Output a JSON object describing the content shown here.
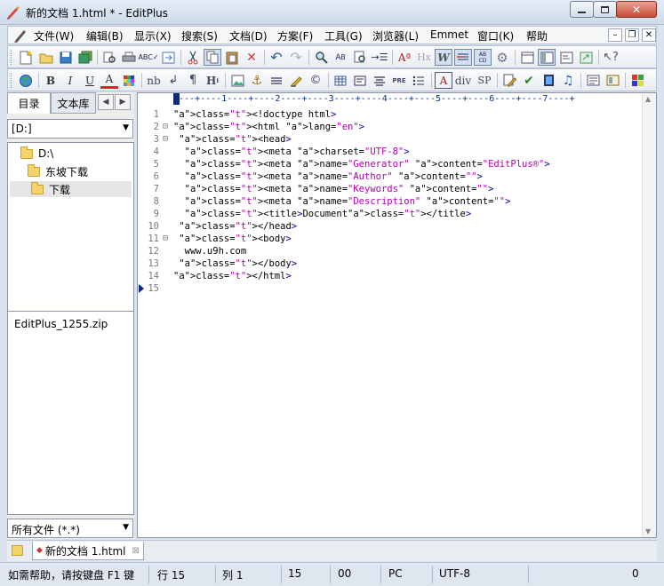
{
  "window": {
    "title": "新的文档 1.html * - EditPlus"
  },
  "menu": [
    "文件(W)",
    "编辑(B)",
    "显示(X)",
    "搜索(S)",
    "文档(D)",
    "方案(F)",
    "工具(G)",
    "浏览器(L)",
    "Emmet",
    "窗口(K)",
    "帮助"
  ],
  "toolbar2_text": {
    "hx": "Hx",
    "nb": "nb",
    "hh": "H",
    "pre": "PRE",
    "div": "div",
    "sp": "SP",
    "abcd": "AB CD"
  },
  "sidebar": {
    "tabs": [
      "目录",
      "文本库"
    ],
    "drive": "[D:]",
    "tree": [
      "D:\\",
      "东坡下载",
      "下载"
    ],
    "files": [
      "EditPlus_1255.zip"
    ],
    "filter": "所有文件 (*.*)"
  },
  "ruler": "----+----1----+----2----+----3----+----4----+----5----+----6----+----7----+",
  "code": [
    {
      "n": "1",
      "fold": "",
      "text": "<!doctype html>"
    },
    {
      "n": "2",
      "fold": "⊟",
      "text": "<html lang=\"en\">"
    },
    {
      "n": "3",
      "fold": "⊟",
      "text": " <head>"
    },
    {
      "n": "4",
      "fold": "",
      "text": "  <meta charset=\"UTF-8\">"
    },
    {
      "n": "5",
      "fold": "",
      "text": "  <meta name=\"Generator\" content=\"EditPlus®\">"
    },
    {
      "n": "6",
      "fold": "",
      "text": "  <meta name=\"Author\" content=\"\">"
    },
    {
      "n": "7",
      "fold": "",
      "text": "  <meta name=\"Keywords\" content=\"\">"
    },
    {
      "n": "8",
      "fold": "",
      "text": "  <meta name=\"Description\" content=\"\">"
    },
    {
      "n": "9",
      "fold": "",
      "text": "  <title>Document</title>"
    },
    {
      "n": "10",
      "fold": "",
      "text": " </head>"
    },
    {
      "n": "11",
      "fold": "⊟",
      "text": " <body>"
    },
    {
      "n": "12",
      "fold": "",
      "text": "  www.u9h.com"
    },
    {
      "n": "13",
      "fold": "",
      "text": " </body>"
    },
    {
      "n": "14",
      "fold": "",
      "text": "</html>"
    },
    {
      "n": "15",
      "fold": "",
      "text": ""
    }
  ],
  "doctab": {
    "label": "新的文档 1.html"
  },
  "status": {
    "help": "如需帮助，请按键盘 F1 键",
    "line": "行 15",
    "col": "列 1",
    "n15": "15",
    "n00": "00",
    "pc": "PC",
    "encoding": "UTF-8",
    "zero": "0"
  }
}
